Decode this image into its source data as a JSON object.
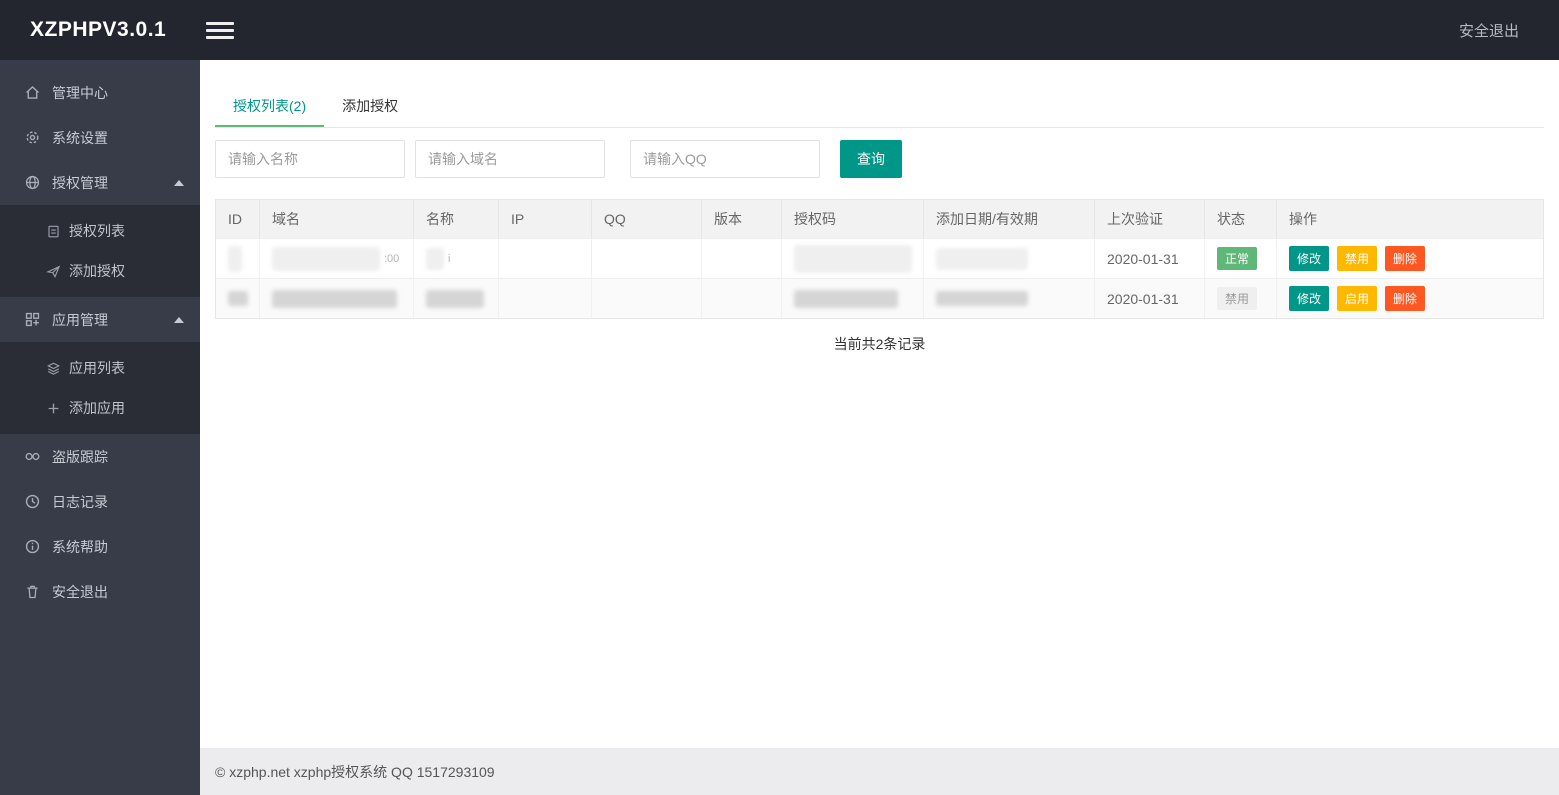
{
  "app": {
    "title": "XZPHPV3.0.1",
    "logout_label": "安全退出"
  },
  "sidebar": {
    "items": [
      {
        "label": "管理中心",
        "icon": "home-icon"
      },
      {
        "label": "系统设置",
        "icon": "gear-icon"
      },
      {
        "label": "授权管理",
        "icon": "globe-icon",
        "expanded": true
      },
      {
        "label": "应用管理",
        "icon": "grid-icon",
        "expanded": true
      },
      {
        "label": "盗版跟踪",
        "icon": "infinity-icon"
      },
      {
        "label": "日志记录",
        "icon": "clock-icon"
      },
      {
        "label": "系统帮助",
        "icon": "info-icon"
      },
      {
        "label": "安全退出",
        "icon": "trash-icon"
      }
    ],
    "auth_children": [
      {
        "label": "授权列表",
        "icon": "doc-list-icon"
      },
      {
        "label": "添加授权",
        "icon": "send-icon"
      }
    ],
    "app_children": [
      {
        "label": "应用列表",
        "icon": "layers-icon"
      },
      {
        "label": "添加应用",
        "icon": "plus-icon"
      }
    ]
  },
  "tabs": [
    {
      "label": "授权列表(2)",
      "active": true
    },
    {
      "label": "添加授权",
      "active": false
    }
  ],
  "search": {
    "name_placeholder": "请输入名称",
    "domain_placeholder": "请输入域名",
    "qq_placeholder": "请输入QQ",
    "submit_label": "查询"
  },
  "table": {
    "columns": [
      "ID",
      "域名",
      "名称",
      "IP",
      "QQ",
      "版本",
      "授权码",
      "添加日期/有效期",
      "上次验证",
      "状态",
      "操作"
    ],
    "rows": [
      {
        "redacted": true,
        "fragments": {
          "domain": ":00",
          "name": "i"
        },
        "last_verified": "2020-01-31",
        "status": "正常",
        "actions": [
          "修改",
          "禁用",
          "删除"
        ]
      },
      {
        "redacted": true,
        "last_verified": "2020-01-31",
        "status": "禁用",
        "actions": [
          "修改",
          "启用",
          "删除"
        ]
      }
    ],
    "summary": "当前共2条记录"
  },
  "footer": {
    "copyright": "© xzphp.net xzphp授权系统 QQ 1517293109"
  },
  "colors": {
    "header_bg": "#23262E",
    "sidebar_bg": "#383C48",
    "submenu_bg": "#2A2D35",
    "accent_teal": "#009688",
    "status_green": "#5FB878",
    "warning_yellow": "#FFB800",
    "danger_red": "#FF5722"
  }
}
